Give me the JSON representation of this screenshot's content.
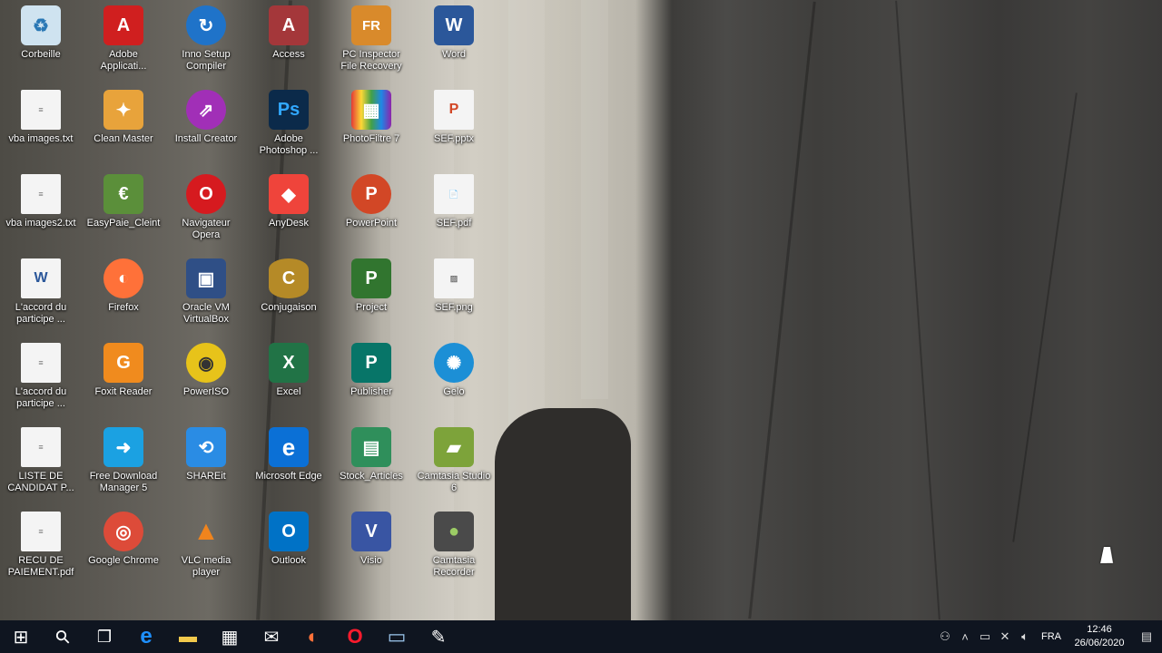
{
  "desktop": {
    "icons": [
      {
        "label": "Corbeille",
        "icon": "recycle-bin-icon",
        "color": "#9ecbe6",
        "text": "♻"
      },
      {
        "label": "Adobe Applicati...",
        "icon": "adobe-icon",
        "color": "#d01f1f",
        "text": "A"
      },
      {
        "label": "Inno Setup Compiler",
        "icon": "inno-setup-icon",
        "color": "#1f73c9",
        "text": "↻"
      },
      {
        "label": "Access",
        "icon": "access-icon",
        "color": "#a4373a",
        "text": "A"
      },
      {
        "label": "PC Inspector File Recovery",
        "icon": "pc-inspector-icon",
        "color": "#d98a2b",
        "text": "FR"
      },
      {
        "label": "Word",
        "icon": "word-icon",
        "color": "#2b579a",
        "text": "W"
      },
      {
        "label": "vba images.txt",
        "icon": "text-file-icon",
        "color": "#f4f4f4",
        "text": "≡"
      },
      {
        "label": "Clean Master",
        "icon": "clean-master-icon",
        "color": "#e8a33b",
        "text": "✦"
      },
      {
        "label": "Install Creator",
        "icon": "install-creator-icon",
        "color": "#a12fb7",
        "text": "⇗"
      },
      {
        "label": "Adobe Photoshop ...",
        "icon": "photoshop-icon",
        "color": "#0b2a4a",
        "text": "Ps"
      },
      {
        "label": "PhotoFiltre 7",
        "icon": "photofiltre-icon",
        "color": "#3f8e3f",
        "text": "▦"
      },
      {
        "label": "SEF.pptx",
        "icon": "pptx-file-icon",
        "color": "#f4f4f4",
        "text": "P"
      },
      {
        "label": "vba images2.txt",
        "icon": "text-file-icon",
        "color": "#f4f4f4",
        "text": "≡"
      },
      {
        "label": "EasyPaie_Cleint",
        "icon": "easypaie-icon",
        "color": "#5b8f3a",
        "text": "€"
      },
      {
        "label": "Navigateur Opera",
        "icon": "opera-icon",
        "color": "#d61a1f",
        "text": "O"
      },
      {
        "label": "AnyDesk",
        "icon": "anydesk-icon",
        "color": "#ef443b",
        "text": "◆"
      },
      {
        "label": "PowerPoint",
        "icon": "powerpoint-icon",
        "color": "#d24726",
        "text": "P"
      },
      {
        "label": "SEF.pdf",
        "icon": "pdf-file-icon",
        "color": "#f4f4f4",
        "text": "📄"
      },
      {
        "label": "L'accord du participe ...",
        "icon": "word-doc-icon",
        "color": "#f4f4f4",
        "text": "W"
      },
      {
        "label": "Firefox",
        "icon": "firefox-icon",
        "color": "#ff7139",
        "text": "◐"
      },
      {
        "label": "Oracle VM VirtualBox",
        "icon": "virtualbox-icon",
        "color": "#2f4f86",
        "text": "▣"
      },
      {
        "label": "Conjugaison",
        "icon": "conjugaison-icon",
        "color": "#b58a27",
        "text": "C"
      },
      {
        "label": "Project",
        "icon": "project-icon",
        "color": "#31752f",
        "text": "P"
      },
      {
        "label": "SEF.png",
        "icon": "png-file-icon",
        "color": "#f4f4f4",
        "text": "▨"
      },
      {
        "label": "L'accord du participe ...",
        "icon": "pdf-doc-icon",
        "color": "#f4f4f4",
        "text": "≡"
      },
      {
        "label": "Foxit Reader",
        "icon": "foxit-icon",
        "color": "#f08b1e",
        "text": "G"
      },
      {
        "label": "PowerISO",
        "icon": "poweriso-icon",
        "color": "#e7c31a",
        "text": "◉"
      },
      {
        "label": "Excel",
        "icon": "excel-icon",
        "color": "#217346",
        "text": "X"
      },
      {
        "label": "Publisher",
        "icon": "publisher-icon",
        "color": "#077568",
        "text": "P"
      },
      {
        "label": "Gelo",
        "icon": "gelo-icon",
        "color": "#1c8fd6",
        "text": "✺"
      },
      {
        "label": "LISTE DE CANDIDAT P...",
        "icon": "pdf-doc-icon",
        "color": "#f4f4f4",
        "text": "≡"
      },
      {
        "label": "Free Download Manager 5",
        "icon": "fdm-icon",
        "color": "#1ba1e2",
        "text": "➜"
      },
      {
        "label": "SHAREit",
        "icon": "shareit-icon",
        "color": "#2a8ce4",
        "text": "⟲"
      },
      {
        "label": "Microsoft Edge",
        "icon": "edge-icon",
        "color": "#0b70d6",
        "text": "e"
      },
      {
        "label": "Stock_Articles",
        "icon": "stock-articles-icon",
        "color": "#2f8f5b",
        "text": "▤"
      },
      {
        "label": "Camtasia Studio 6",
        "icon": "camtasia-studio-icon",
        "color": "#7da33a",
        "text": "▰"
      },
      {
        "label": "RECU DE PAIEMENT.pdf",
        "icon": "pdf-doc-icon",
        "color": "#f4f4f4",
        "text": "≡"
      },
      {
        "label": "Google Chrome",
        "icon": "chrome-icon",
        "color": "#dd4b39",
        "text": "◎"
      },
      {
        "label": "VLC media player",
        "icon": "vlc-icon",
        "color": "#f0841d",
        "text": "▲"
      },
      {
        "label": "Outlook",
        "icon": "outlook-icon",
        "color": "#0072c6",
        "text": "O"
      },
      {
        "label": "Visio",
        "icon": "visio-icon",
        "color": "#3955a3",
        "text": "V"
      },
      {
        "label": "Camtasia Recorder",
        "icon": "camtasia-recorder-icon",
        "color": "#4a4a4a",
        "text": "●"
      }
    ]
  },
  "taskbar": {
    "buttons": [
      {
        "name": "start-button",
        "icon": "windows-icon",
        "glyph": "⊞",
        "color": "#ffffff"
      },
      {
        "name": "search-button",
        "icon": "search-icon",
        "glyph": "⚲",
        "color": "#ffffff"
      },
      {
        "name": "task-view-button",
        "icon": "task-view-icon",
        "glyph": "❐",
        "color": "#ffffff"
      },
      {
        "name": "taskbar-edge",
        "icon": "edge-icon",
        "glyph": "e",
        "color": "#1e90ff"
      },
      {
        "name": "taskbar-explorer",
        "icon": "folder-icon",
        "glyph": "▬",
        "color": "#f2c94c"
      },
      {
        "name": "taskbar-store",
        "icon": "store-icon",
        "glyph": "▦",
        "color": "#ffffff"
      },
      {
        "name": "taskbar-mail",
        "icon": "mail-icon",
        "glyph": "✉",
        "color": "#ffffff"
      },
      {
        "name": "taskbar-firefox",
        "icon": "firefox-icon",
        "glyph": "◐",
        "color": "#ff7139"
      },
      {
        "name": "taskbar-opera",
        "icon": "opera-icon",
        "glyph": "O",
        "color": "#ff1b2d"
      },
      {
        "name": "taskbar-app",
        "icon": "computer-icon",
        "glyph": "▭",
        "color": "#9cc7ee"
      },
      {
        "name": "taskbar-paint",
        "icon": "paint-icon",
        "glyph": "✎",
        "color": "#ffffff"
      }
    ],
    "tray": {
      "language": "FRA",
      "time": "12:46",
      "date": "26/06/2020"
    }
  }
}
